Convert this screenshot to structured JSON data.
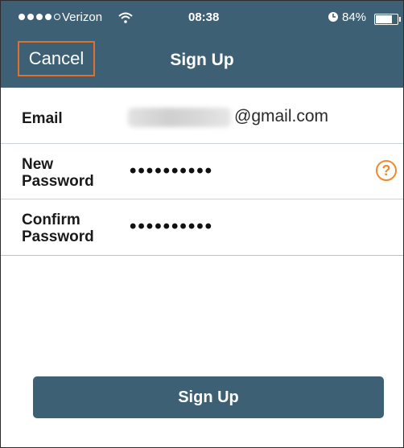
{
  "status_bar": {
    "carrier": "Verizon",
    "time": "08:38",
    "battery_percent": "84%",
    "battery_level": 0.84,
    "signal_bars": 4,
    "signal_bars_total": 5,
    "icons": [
      "wifi-icon",
      "alarm-icon",
      "battery-icon"
    ]
  },
  "nav": {
    "cancel_label": "Cancel",
    "title": "Sign Up"
  },
  "form": {
    "email_label": "Email",
    "email_domain": "@gmail.com",
    "new_password_label_line1": "New",
    "new_password_label_line2": "Password",
    "new_password_value": "••••••••••",
    "confirm_password_label_line1": "Confirm",
    "confirm_password_label_line2": "Password",
    "confirm_password_value": "••••••••••",
    "help_label": "?"
  },
  "actions": {
    "signup_label": "Sign Up"
  },
  "colors": {
    "bar": "#3d6075",
    "accent": "#f08a2c",
    "cancel_border": "#e0702d"
  }
}
